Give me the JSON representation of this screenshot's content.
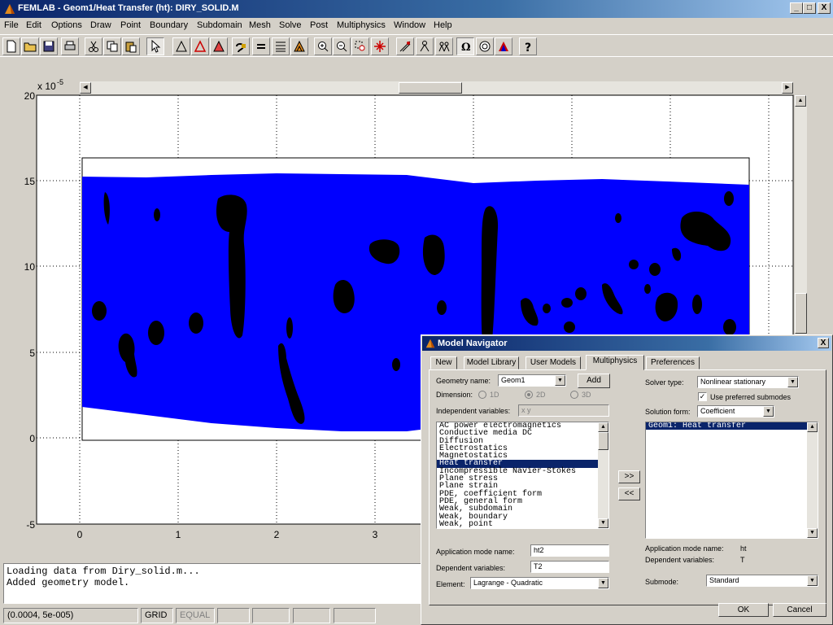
{
  "window": {
    "title": "FEMLAB - Geom1/Heat Transfer (ht): DIRY_SOLID.M",
    "controls": [
      "_",
      "□",
      "X"
    ]
  },
  "menu": [
    "File",
    "Edit",
    "Options",
    "Draw",
    "Point",
    "Boundary",
    "Subdomain",
    "Mesh",
    "Solve",
    "Post",
    "Multiphysics",
    "Window",
    "Help"
  ],
  "toolbar_icons": [
    "new-file-icon",
    "open-folder-icon",
    "save-icon",
    "print-icon",
    "cut-icon",
    "copy-icon",
    "paste-icon",
    "select-arrow-icon",
    "draw-mode-icon",
    "boundary-mode-icon",
    "subdomain-mode-icon",
    "subdomain-settings-icon",
    "equals-icon",
    "mesh-icon",
    "mesh-refine-icon",
    "zoom-in-icon",
    "zoom-out-icon",
    "zoom-window-icon",
    "zoom-extents-icon",
    "mesh-mode-icon",
    "solve-icon",
    "solve-param-icon",
    "omega-icon",
    "plot-icon",
    "post-icon",
    "help-icon"
  ],
  "plot": {
    "y_exponent": "x 10",
    "y_exponent_power": "-5",
    "y_ticks": [
      "20",
      "15",
      "10",
      "5",
      "0",
      "-5"
    ],
    "x_ticks": [
      "0",
      "1",
      "2",
      "3"
    ],
    "domain_color": "#0000ff",
    "particle_color": "#000000"
  },
  "log": {
    "lines": [
      "Loading data from Diry_solid.m...",
      "Added geometry model."
    ]
  },
  "status": {
    "coords": "(0.0004, 5e-005)",
    "grid": "GRID",
    "equal": "EQUAL"
  },
  "dialog": {
    "title": "Model Navigator",
    "close": "X",
    "tabs": [
      "New",
      "Model Library",
      "User Models",
      "Multiphysics",
      "Preferences"
    ],
    "active_tab": "Multiphysics",
    "geometry_label": "Geometry name:",
    "geometry_value": "Geom1",
    "add_button": "Add",
    "dimension_label": "Dimension:",
    "dimension_options": [
      "1D",
      "2D",
      "3D"
    ],
    "independent_label": "Independent variables:",
    "independent_value": "x y",
    "modes": [
      "AC power electromagnetics",
      "Conductive media DC",
      "Diffusion",
      "Electrostatics",
      "Magnetostatics",
      "Heat transfer",
      "Incompressible Navier-Stokes",
      "Plane stress",
      "Plane strain",
      "PDE, coefficient form",
      "PDE, general form",
      "Weak, subdomain",
      "Weak, boundary",
      "Weak, point"
    ],
    "selected_mode": "Heat transfer",
    "add_arrow": ">>",
    "remove_arrow": "<<",
    "app_mode_label": "Application mode name:",
    "app_mode_value": "ht2",
    "dep_vars_label": "Dependent variables:",
    "dep_vars_value": "T2",
    "element_label": "Element:",
    "element_value": "Lagrange - Quadratic",
    "solver_type_label": "Solver type:",
    "solver_type_value": "Nonlinear stationary",
    "use_submodes_label": "Use preferred submodes",
    "use_submodes_checked": "✓",
    "solution_form_label": "Solution form:",
    "solution_form_value": "Coefficient",
    "model_items": [
      "Geom1: Heat transfer"
    ],
    "right_app_mode_label": "Application mode name:",
    "right_app_mode_value": "ht",
    "right_dep_vars_label": "Dependent variables:",
    "right_dep_vars_value": "T",
    "submode_label": "Submode:",
    "submode_value": "Standard",
    "ok_button": "OK",
    "cancel_button": "Cancel"
  }
}
